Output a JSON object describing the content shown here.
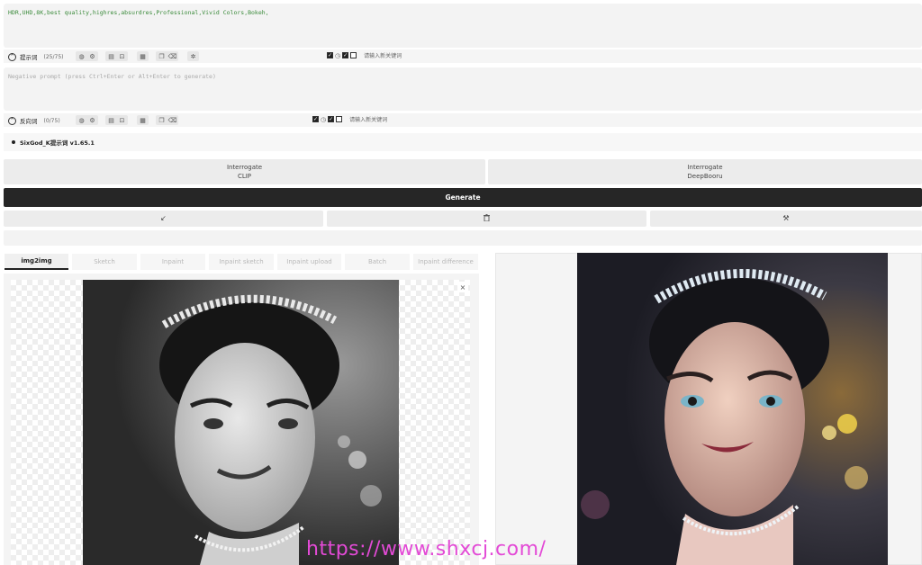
{
  "positive_prompt": {
    "text": "HDR,UHD,8K,best quality,highres,absurdres,Professional,Vivid Colors,Bokeh,",
    "label": "提示词",
    "count": "(25/75)",
    "keyword_placeholder": "请输入新关键词"
  },
  "negative_prompt": {
    "placeholder": "Negative prompt (press Ctrl+Enter or Alt+Enter to generate)",
    "label": "反向词",
    "count": "(0/75)",
    "keyword_placeholder": "请输入新关键词"
  },
  "extension": {
    "label": "SixGod_K提示词 v1.65.1"
  },
  "interrogate": {
    "clip_line1": "Interrogate",
    "clip_line2": "CLIP",
    "deepbooru_line1": "Interrogate",
    "deepbooru_line2": "DeepBooru"
  },
  "generate_label": "Generate",
  "action_icons": {
    "left": "arrow-down-left-icon",
    "middle": "trash-icon",
    "right": "magic-wand-icon"
  },
  "tabs": [
    "img2img",
    "Sketch",
    "Inpaint",
    "Inpaint sketch",
    "Inpaint upload",
    "Batch",
    "Inpaint difference"
  ],
  "active_tab": "img2img",
  "close_glyph": "×",
  "watermark": "https://www.shxcj.com/"
}
